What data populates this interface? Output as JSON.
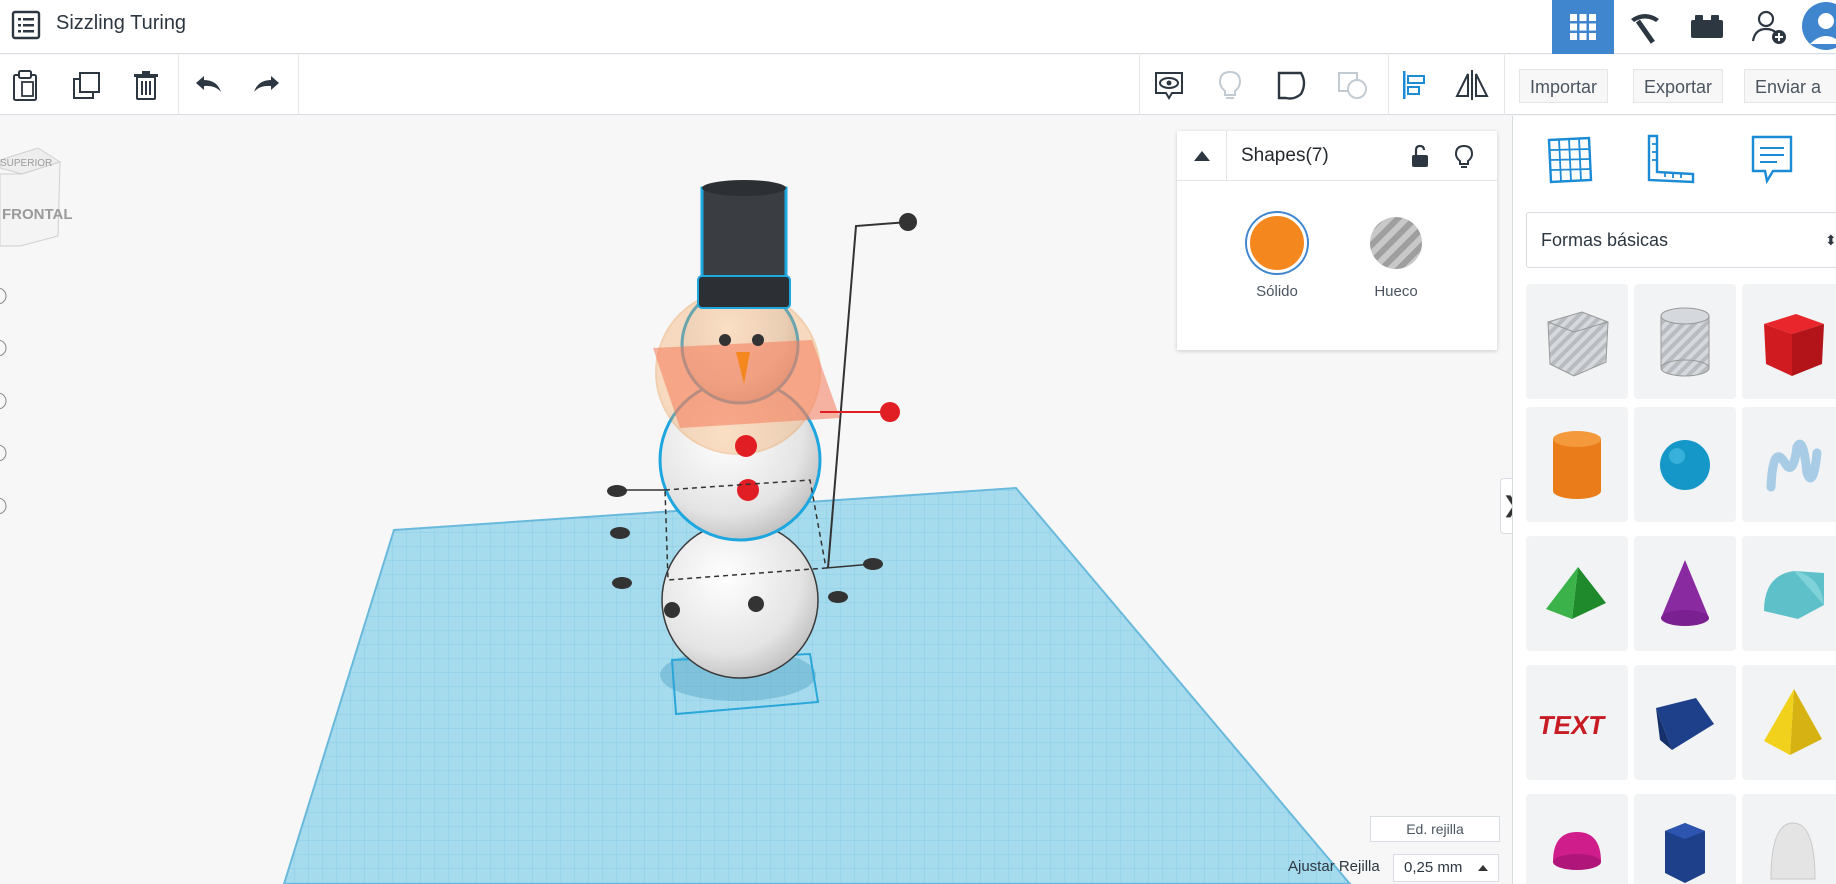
{
  "app": {
    "title": "Sizzling Turing"
  },
  "toolbar": {
    "import_label": "Importar",
    "export_label": "Exportar",
    "send_label": "Enviar a"
  },
  "view_cube": {
    "top_label": "SUPERIOR",
    "front_label": "FRONTAL"
  },
  "inspector": {
    "title": "Shapes(7)",
    "solid_label": "Sólido",
    "hole_label": "Hueco",
    "solid_color": "#f5871f"
  },
  "workplane": {
    "edit_grid_label": "Ed. rejilla",
    "snap_label": "Ajustar Rejilla",
    "snap_value": "0,25 mm",
    "grid_color": "#9fd8ec"
  },
  "library": {
    "category": "Formas básicas",
    "shapes": [
      "box-hole",
      "cylinder-hole",
      "box",
      "cylinder",
      "sphere",
      "scribble",
      "roof",
      "cone",
      "round-roof",
      "text",
      "wedge",
      "pyramid",
      "half-sphere",
      "polygon",
      "paraboloid"
    ]
  },
  "colors": {
    "accent": "#3f86cf",
    "primary_blue": "#1a8bd4"
  }
}
